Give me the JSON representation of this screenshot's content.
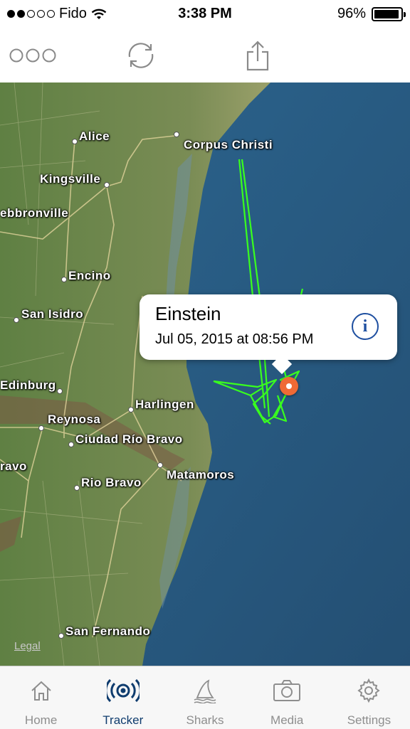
{
  "status_bar": {
    "carrier": "Fido",
    "time": "3:38 PM",
    "battery": "96%",
    "signal_bars_filled": 2,
    "signal_bars_total": 5
  },
  "toolbar": {
    "more_icon": "more-icon",
    "refresh_icon": "refresh-icon",
    "share_icon": "share-icon"
  },
  "map": {
    "legal": "Legal",
    "places": [
      {
        "name": "Corpus Christi"
      },
      {
        "name": "Alice"
      },
      {
        "name": "Kingsville"
      },
      {
        "name": "ebbronville"
      },
      {
        "name": "Encino"
      },
      {
        "name": "San Isidro"
      },
      {
        "name": "Edinburg"
      },
      {
        "name": "Reynosa"
      },
      {
        "name": "Harlingen"
      },
      {
        "name": "Ciudad Río Bravo"
      },
      {
        "name": "ravo"
      },
      {
        "name": "Matamoros"
      },
      {
        "name": "Rio Bravo"
      },
      {
        "name": "San Fernando"
      }
    ],
    "track_color": "#39ff1e",
    "water_color": "#2a5d86",
    "land_color": "#6b8a4a"
  },
  "callout": {
    "name": "Einstein",
    "date": "Jul 05, 2015 at 08:56 PM",
    "info_glyph": "i"
  },
  "pin_color": "#ef6a35",
  "tabs": [
    {
      "label": "Home",
      "icon": "home-icon",
      "active": false
    },
    {
      "label": "Tracker",
      "icon": "tracker-icon",
      "active": true
    },
    {
      "label": "Sharks",
      "icon": "shark-fin-icon",
      "active": false
    },
    {
      "label": "Media",
      "icon": "camera-icon",
      "active": false
    },
    {
      "label": "Settings",
      "icon": "gear-icon",
      "active": false
    }
  ]
}
